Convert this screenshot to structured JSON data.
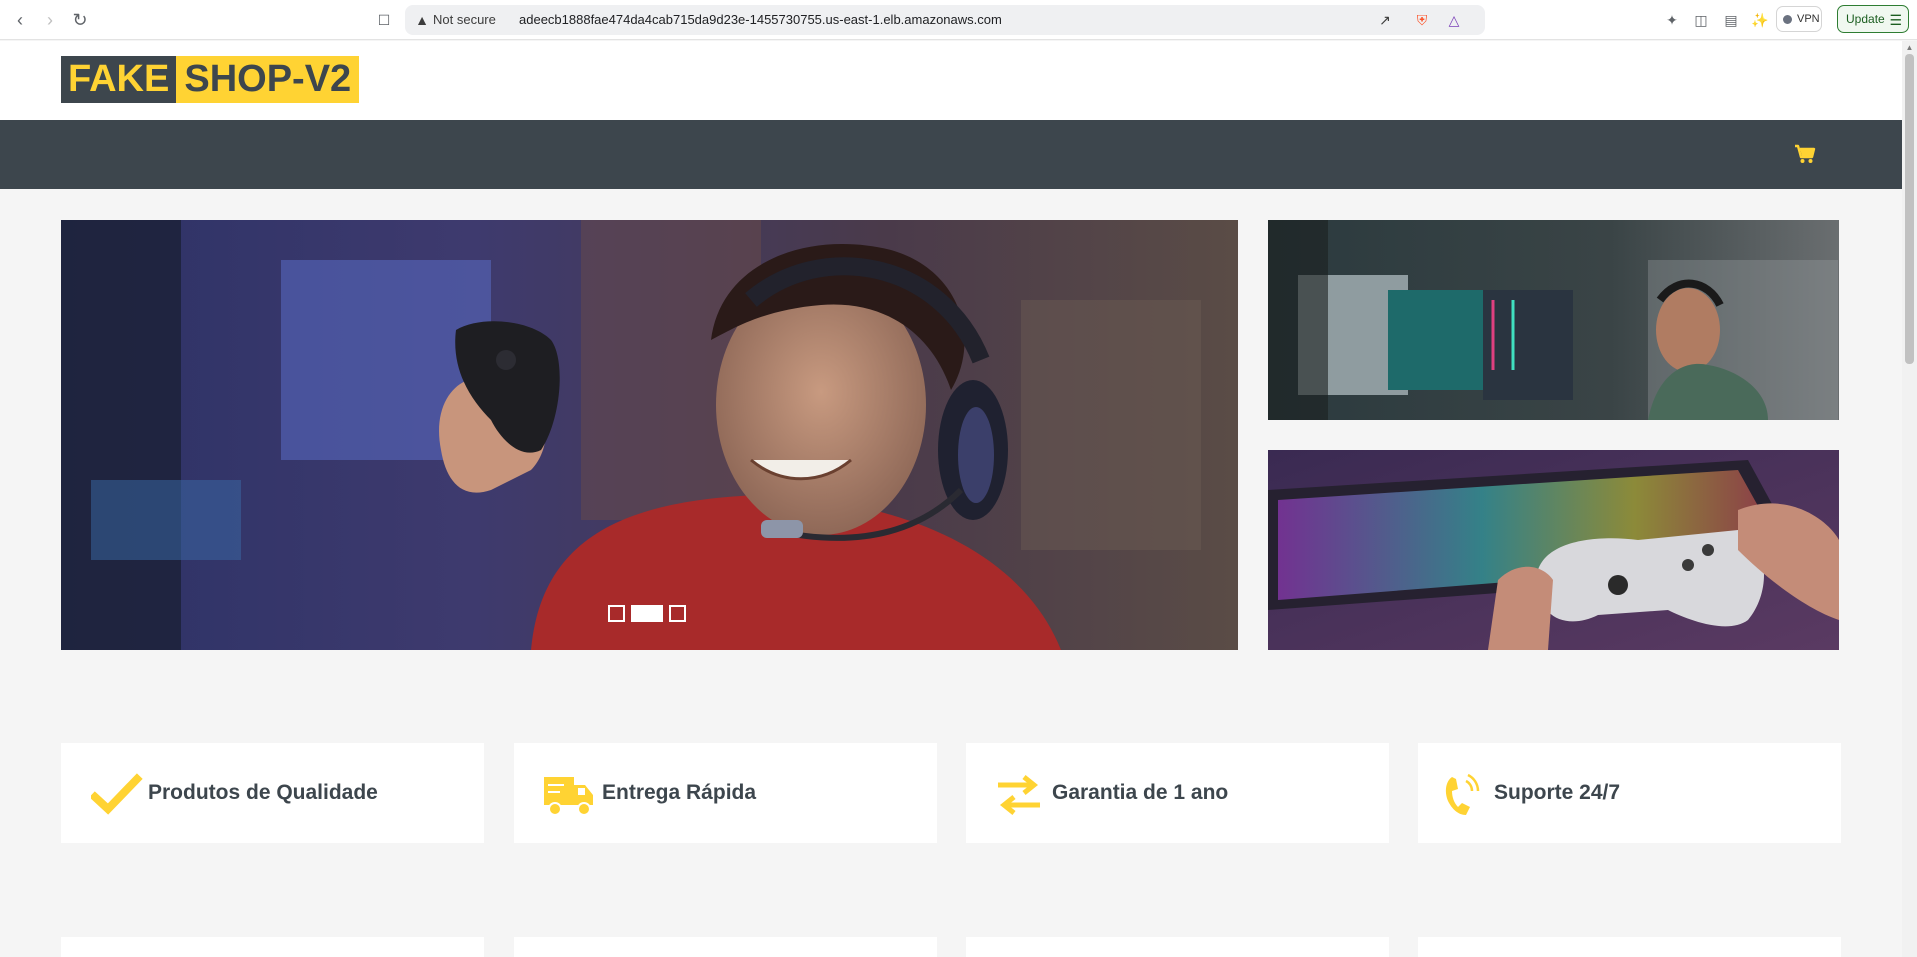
{
  "browser": {
    "security_label": "Not secure",
    "url": "adeecb1888fae474da4cab715da9d23e-1455730755.us-east-1.elb.amazonaws.com",
    "vpn_label": "VPN",
    "update_label": "Update"
  },
  "site": {
    "logo_part1": "FAKE",
    "logo_part2": "SHOP-V2"
  },
  "carousel": {
    "indicator_count": 3,
    "active_index": 1
  },
  "features": [
    {
      "label": "Produtos de Qualidade",
      "icon": "check-icon"
    },
    {
      "label": "Entrega Rápida",
      "icon": "truck-icon"
    },
    {
      "label": "Garantia de 1 ano",
      "icon": "exchange-icon"
    },
    {
      "label": "Suporte 24/7",
      "icon": "phone-icon"
    }
  ],
  "colors": {
    "brand_dark": "#3d464d",
    "brand_yellow": "#ffd333",
    "background": "#f5f5f5"
  }
}
